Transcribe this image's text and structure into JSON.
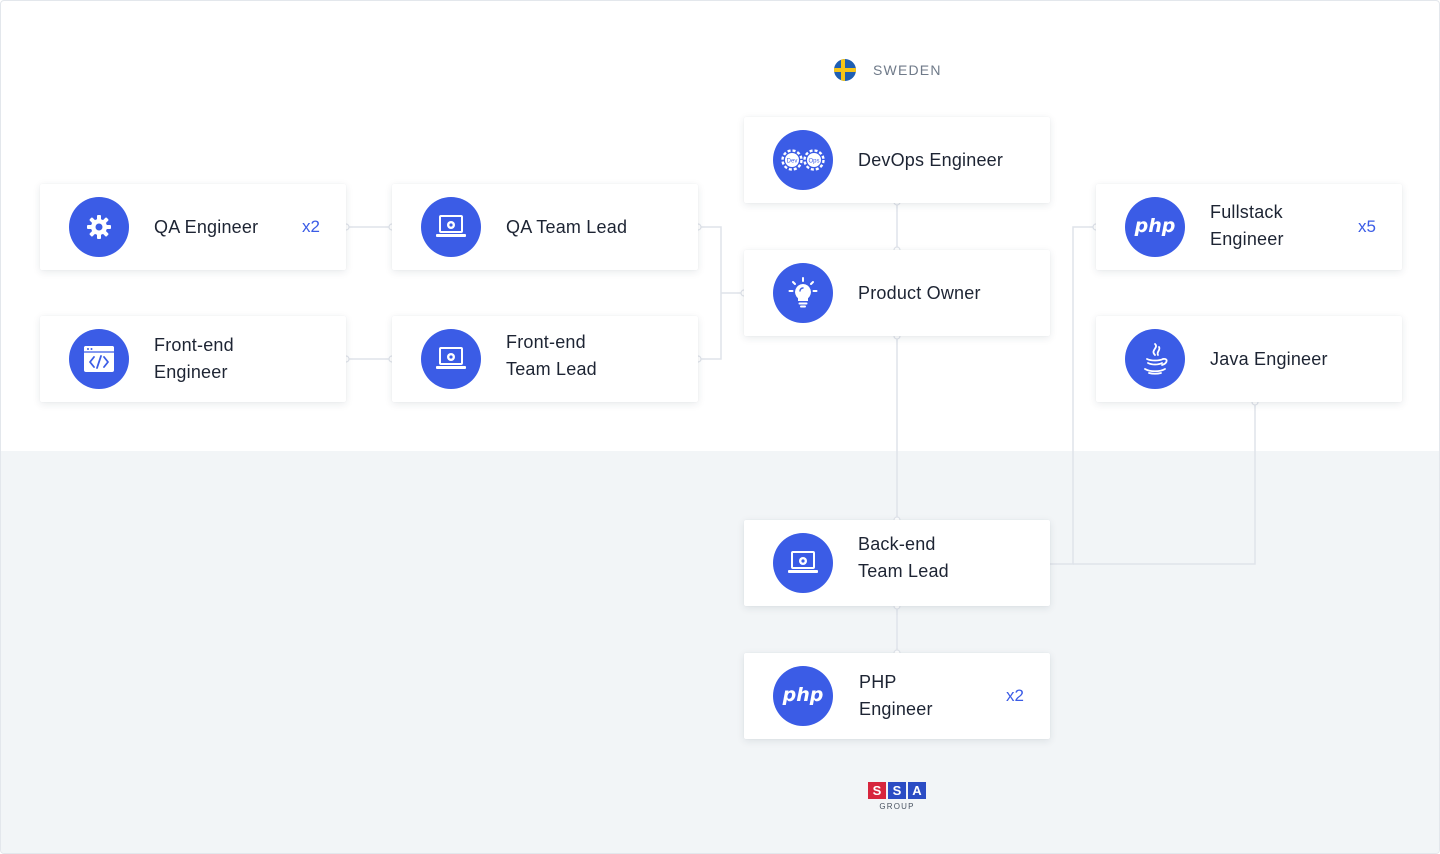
{
  "country": {
    "name": "SWEDEN",
    "flag_colors": {
      "field": "#1f5fb3",
      "cross": "#f5c518"
    }
  },
  "accent_color": "#3b5ce6",
  "nodes": [
    {
      "id": "qa-engineer",
      "icon": "gear-icon",
      "lines": [
        "QA Engineer"
      ],
      "count": "x2"
    },
    {
      "id": "qa-team-lead",
      "icon": "laptop-gear-icon",
      "lines": [
        "QA Team Lead"
      ],
      "count": ""
    },
    {
      "id": "frontend-engineer",
      "icon": "code-window-icon",
      "lines": [
        "Front-end",
        "Engineer"
      ],
      "count": ""
    },
    {
      "id": "frontend-team-lead",
      "icon": "laptop-gear-icon",
      "lines": [
        "Front-end",
        "Team Lead"
      ],
      "count": ""
    },
    {
      "id": "devops-engineer",
      "icon": "devops-gears-icon",
      "lines": [
        "DevOps Engineer"
      ],
      "count": ""
    },
    {
      "id": "product-owner",
      "icon": "lightbulb-icon",
      "lines": [
        "Product Owner"
      ],
      "count": ""
    },
    {
      "id": "fullstack-engineer",
      "icon": "php-icon",
      "lines": [
        "Fullstack",
        "Engineer"
      ],
      "count": "x5"
    },
    {
      "id": "java-engineer",
      "icon": "java-icon",
      "lines": [
        "Java Engineer"
      ],
      "count": ""
    },
    {
      "id": "backend-team-lead",
      "icon": "laptop-gear-icon",
      "lines": [
        "Back-end",
        "Team Lead"
      ],
      "count": ""
    },
    {
      "id": "php-engineer",
      "icon": "php-icon",
      "lines": [
        "PHP",
        "Engineer"
      ],
      "count": "x2"
    }
  ],
  "edges": [
    [
      "qa-engineer",
      "qa-team-lead"
    ],
    [
      "frontend-engineer",
      "frontend-team-lead"
    ],
    [
      "qa-team-lead",
      "product-owner"
    ],
    [
      "frontend-team-lead",
      "product-owner"
    ],
    [
      "devops-engineer",
      "product-owner"
    ],
    [
      "product-owner",
      "backend-team-lead"
    ],
    [
      "backend-team-lead",
      "php-engineer"
    ],
    [
      "backend-team-lead",
      "fullstack-engineer"
    ],
    [
      "backend-team-lead",
      "java-engineer"
    ]
  ],
  "logo": {
    "letters": [
      "S",
      "S",
      "A"
    ],
    "subtitle": "GROUP",
    "colors": [
      "#d7263d",
      "#2b4cc4",
      "#2b4cc4"
    ]
  },
  "icon_text": {
    "php": "php",
    "devops": [
      "Dev",
      "Ops"
    ]
  }
}
